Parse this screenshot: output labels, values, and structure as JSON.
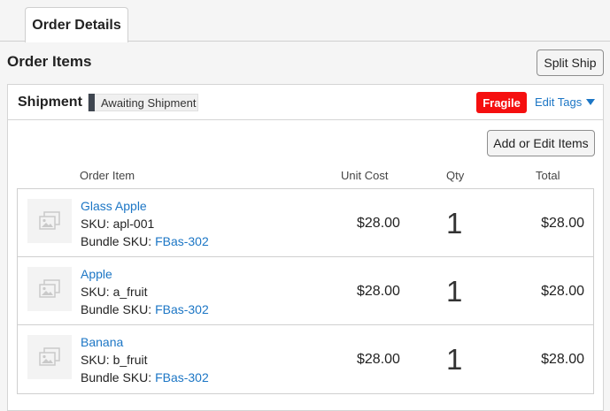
{
  "tabs": [
    {
      "label": "Order Details",
      "active": true
    }
  ],
  "section_title": "Order Items",
  "split_ship_label": "Split Ship",
  "shipment": {
    "title": "Shipment",
    "status": "Awaiting Shipment",
    "tag": "Fragile",
    "edit_tags_label": "Edit Tags",
    "add_edit_label": "Add or Edit Items",
    "columns": {
      "item": "Order Item",
      "unit_cost": "Unit Cost",
      "qty": "Qty",
      "total": "Total"
    },
    "items": [
      {
        "name": "Glass Apple",
        "sku": "SKU: apl-001",
        "bundle_label": "Bundle SKU: ",
        "bundle_sku": "FBas-302",
        "unit_cost": "$28.00",
        "qty": "1",
        "total": "$28.00"
      },
      {
        "name": "Apple",
        "sku": "SKU: a_fruit",
        "bundle_label": "Bundle SKU: ",
        "bundle_sku": "FBas-302",
        "unit_cost": "$28.00",
        "qty": "1",
        "total": "$28.00"
      },
      {
        "name": "Banana",
        "sku": "SKU: b_fruit",
        "bundle_label": "Bundle SKU: ",
        "bundle_sku": "FBas-302",
        "unit_cost": "$28.00",
        "qty": "1",
        "total": "$28.00"
      }
    ]
  },
  "colors": {
    "accent": "#1c76c5",
    "fragile": "#f50f0f",
    "status_bar": "#3f4650"
  },
  "icons": {
    "thumbnail": "image-placeholder-icon",
    "dropdown": "triangle-down-icon"
  }
}
